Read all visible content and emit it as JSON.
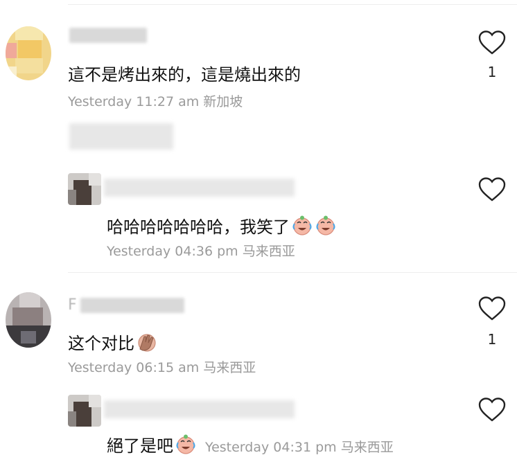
{
  "comments": [
    {
      "text": "這不是烤出來的，這是燒出來的",
      "time": "Yesterday 11:27 am",
      "location": "新加坡",
      "likes": "1",
      "replies": [
        {
          "text": "哈哈哈哈哈哈哈，我笑了",
          "time": "Yesterday 04:36 pm",
          "location": "马来西亚",
          "emojis": [
            "crying-laughing-face-emoji",
            "crying-laughing-face-emoji"
          ]
        }
      ]
    },
    {
      "name_initial": "F",
      "text": "这个对比",
      "time": "Yesterday 06:15 am",
      "location": "马来西亚",
      "likes": "1",
      "emojis": [
        "facepalm-emoji"
      ],
      "replies": [
        {
          "text": "絕了是吧",
          "time": "Yesterday 04:31 pm",
          "location": "马来西亚",
          "emojis": [
            "crying-laughing-face-emoji"
          ]
        }
      ]
    }
  ],
  "colors": {
    "meta": "#9a9a9a",
    "text": "#111111",
    "divider": "#ededed"
  }
}
